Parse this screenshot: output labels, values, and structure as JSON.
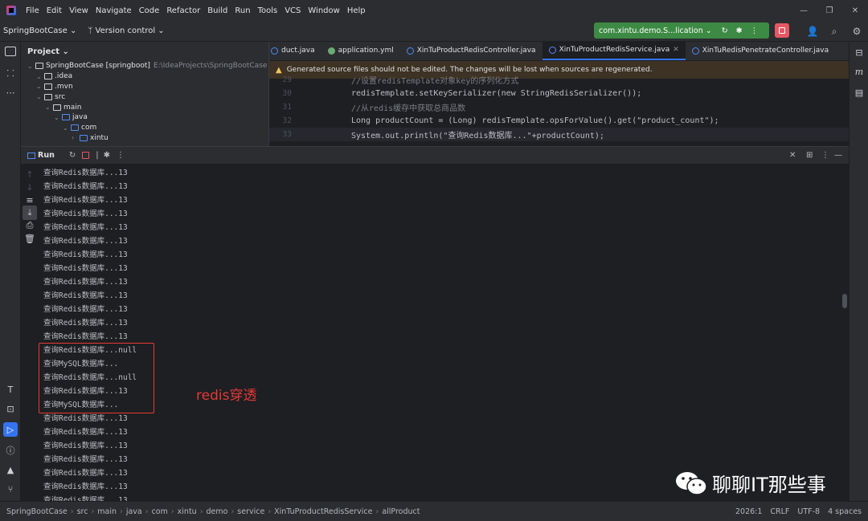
{
  "menu": [
    "File",
    "Edit",
    "View",
    "Navigate",
    "Code",
    "Refactor",
    "Build",
    "Run",
    "Tools",
    "VCS",
    "Window",
    "Help"
  ],
  "toolbar": {
    "project": "SpringBootCase ⌄",
    "vcs": "Version control ⌄",
    "run_config": "com.xintu.demo.S...lication ⌄"
  },
  "project_pane": {
    "title": "Project ⌄",
    "tree": [
      {
        "label": "SpringBootCase [springboot]",
        "path": "E:\\IdeaProjects\\SpringBootCase",
        "indent": 0
      },
      {
        "label": ".idea",
        "indent": 1
      },
      {
        "label": ".mvn",
        "indent": 1
      },
      {
        "label": "src",
        "indent": 1
      },
      {
        "label": "main",
        "indent": 2
      },
      {
        "label": "java",
        "indent": 3
      },
      {
        "label": "com",
        "indent": 4
      },
      {
        "label": "xintu",
        "indent": 5
      }
    ]
  },
  "editor": {
    "tabs": [
      {
        "label": "duct.java",
        "active": false
      },
      {
        "label": "application.yml",
        "active": false
      },
      {
        "label": "XinTuProductRedisController.java",
        "active": false
      },
      {
        "label": "XinTuProductRedisService.java",
        "active": true
      },
      {
        "label": "XinTuRedisPenetrateController.java",
        "active": false
      }
    ],
    "warning": "Generated source files should not be edited. The changes will be lost when sources are regenerated.",
    "lines": [
      {
        "n": "29",
        "code": "//设置redisTemplate对象key的序列化方式"
      },
      {
        "n": "30",
        "code": "redisTemplate.setKeySerializer(new StringRedisSerializer());"
      },
      {
        "n": "31",
        "code": "//从redis缓存中获取总商品数"
      },
      {
        "n": "32",
        "code": "Long productCount = (Long) redisTemplate.opsForValue().get(\"product_count\");"
      },
      {
        "n": "33",
        "code": "System.out.println(\"查询Redis数据库...\"+productCount);"
      }
    ]
  },
  "run_panel": {
    "tab": "Run",
    "console": [
      "查询Redis数据库...13",
      "查询Redis数据库...13",
      "查询Redis数据库...13",
      "查询Redis数据库...13",
      "查询Redis数据库...13",
      "查询Redis数据库...13",
      "查询Redis数据库...13",
      "查询Redis数据库...13",
      "查询Redis数据库...13",
      "查询Redis数据库...13",
      "查询Redis数据库...13",
      "查询Redis数据库...13",
      "查询Redis数据库...13",
      "查询Redis数据库...null",
      "查询MySQL数据库...",
      "查询Redis数据库...null",
      "查询Redis数据库...13",
      "查询MySQL数据库...",
      "查询Redis数据库...13",
      "查询Redis数据库...13",
      "查询Redis数据库...13",
      "查询Redis数据库...13",
      "查询Redis数据库...13",
      "查询Redis数据库...13",
      "查询Redis数据库...13"
    ],
    "annotation": "redis穿透"
  },
  "watermark": "聊聊IT那些事",
  "statusbar": {
    "breadcrumbs": [
      "SpringBootCase",
      "src",
      "main",
      "java",
      "com",
      "xintu",
      "demo",
      "service",
      "XinTuProductRedisService",
      "allProduct"
    ],
    "position": "2026:1",
    "line_sep": "CRLF",
    "encoding": "UTF-8",
    "indent": "4 spaces"
  },
  "colors": {
    "accent": "#3574f0",
    "run_green": "#3d8a44",
    "stop_red": "#e55765",
    "annotation_red": "#e53935"
  }
}
